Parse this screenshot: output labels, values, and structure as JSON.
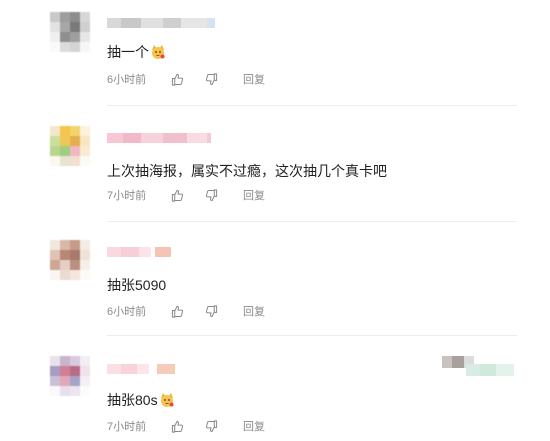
{
  "comments": [
    {
      "text": "抽一个",
      "emoji": "cat-emoji",
      "time": "6小时前",
      "reply": "回复"
    },
    {
      "text": "上次抽海报，属实不过瘾，这次抽几个真卡吧",
      "time": "7小时前",
      "reply": "回复"
    },
    {
      "text": "抽张5090",
      "time": "6小时前",
      "reply": "回复"
    },
    {
      "text": "抽张80s",
      "emoji": "cat-emoji",
      "time": "7小时前",
      "reply": "回复"
    }
  ],
  "icons": {
    "like": "thumb-up-icon",
    "dislike": "thumb-down-icon"
  },
  "colors": {
    "text": "#222222",
    "meta": "#8a8a8a",
    "divider": "#ececec"
  }
}
